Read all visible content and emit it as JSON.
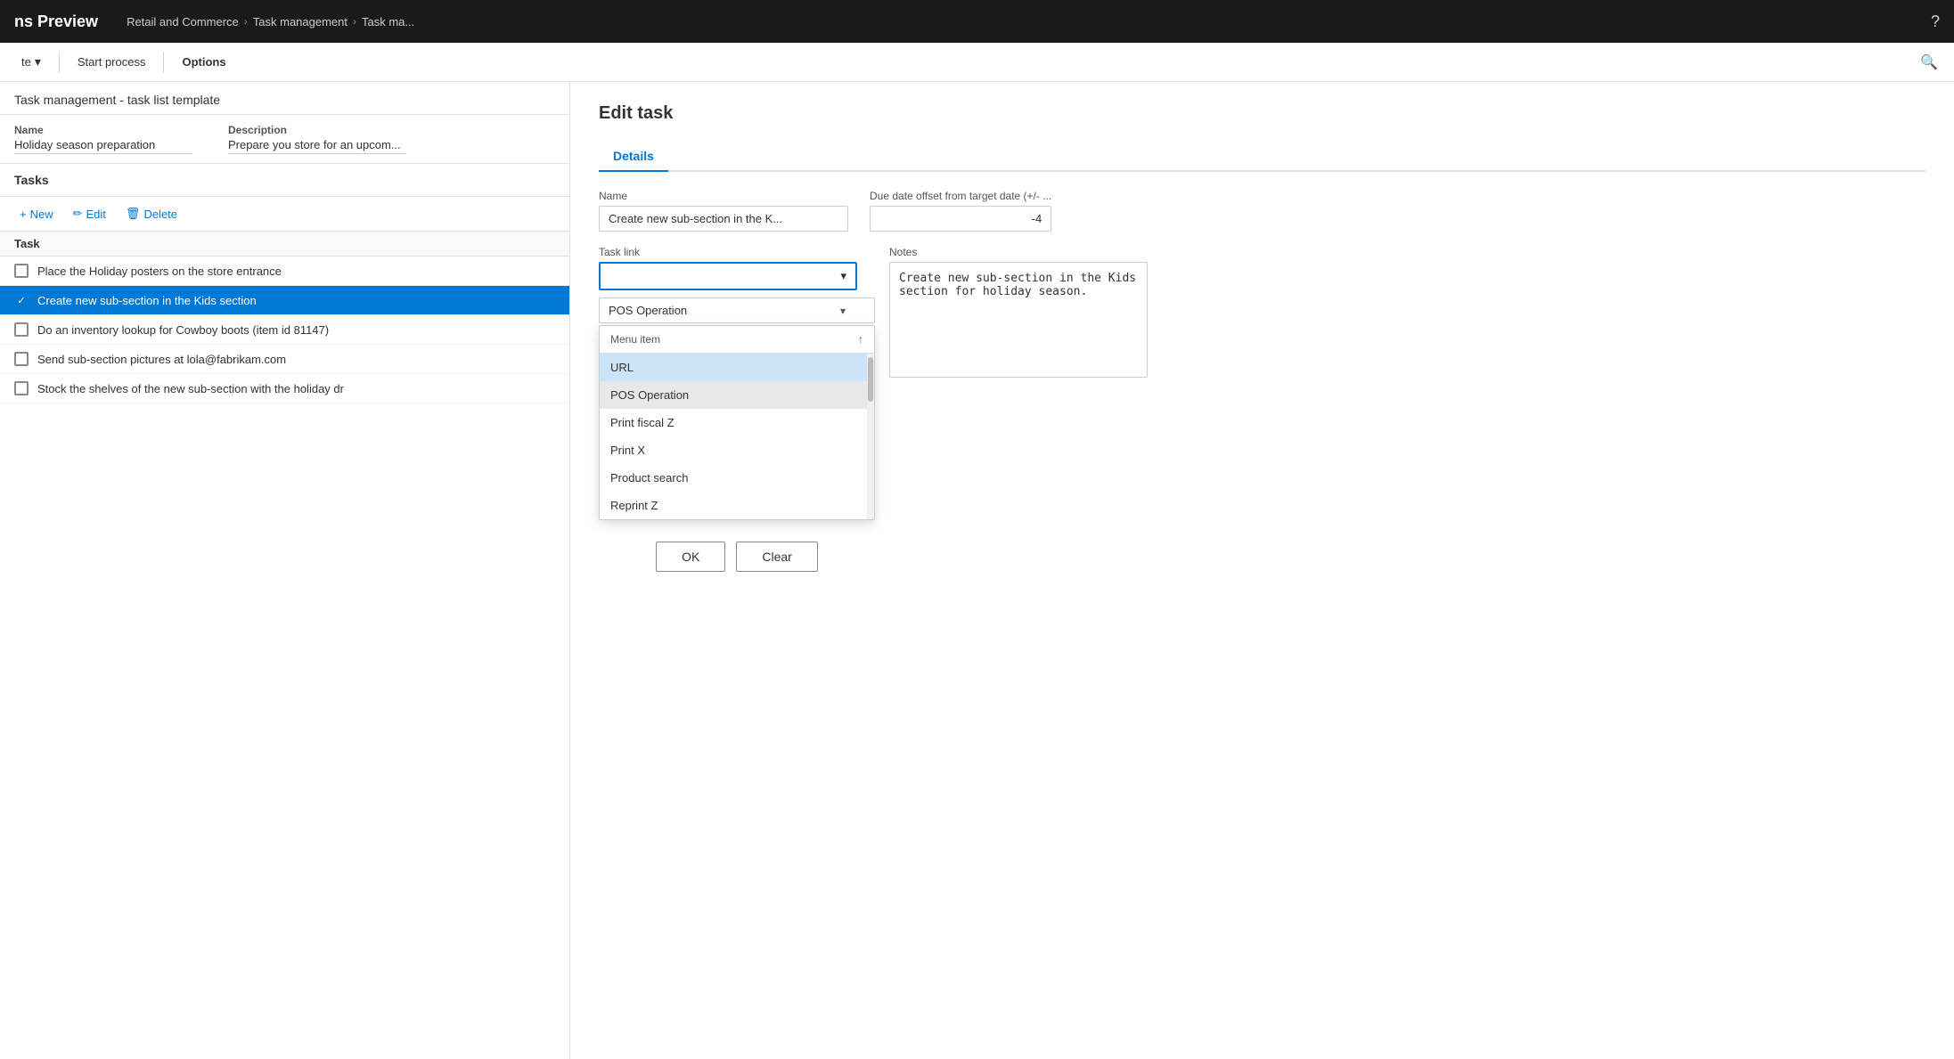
{
  "topNav": {
    "appTitle": "ns Preview",
    "breadcrumb": [
      "Retail and Commerce",
      "Task management",
      "Task ma..."
    ],
    "helpIcon": "?"
  },
  "toolbar": {
    "updateLabel": "te",
    "startProcessLabel": "Start process",
    "optionsLabel": "Options",
    "searchIcon": "🔍"
  },
  "leftPanel": {
    "pageTitle": "Task management - task list template",
    "nameLabel": "Name",
    "nameValue": "Holiday season preparation",
    "descriptionLabel": "Description",
    "descriptionValue": "Prepare you store for an upcom...",
    "tasksHeader": "Tasks",
    "newLabel": "+ New",
    "editLabel": "Edit",
    "deleteLabel": "Delete",
    "taskHeaderLabel": "Task",
    "tasks": [
      {
        "id": 1,
        "text": "Place the Holiday posters on the store entrance",
        "checked": false,
        "selected": false
      },
      {
        "id": 2,
        "text": "Create new sub-section in the Kids section",
        "checked": true,
        "selected": true
      },
      {
        "id": 3,
        "text": "Do an inventory lookup for Cowboy boots (item id 81147)",
        "checked": false,
        "selected": false
      },
      {
        "id": 4,
        "text": "Send sub-section pictures at lola@fabrikam.com",
        "checked": false,
        "selected": false
      },
      {
        "id": 5,
        "text": "Stock the shelves of the new sub-section with the holiday dr",
        "checked": false,
        "selected": false
      }
    ]
  },
  "rightPanel": {
    "title": "Edit task",
    "tabs": [
      "Details"
    ],
    "activeTab": "Details",
    "nameLabel": "Name",
    "nameValue": "Create new sub-section in the K...",
    "dueDateLabel": "Due date offset from target date (+/- ...",
    "dueDateValue": "-4",
    "taskLinkLabel": "Task link",
    "taskLinkValue": "",
    "taskLinkPlaceholder": "",
    "notesLabel": "Notes",
    "notesValue": "Create new sub-section in the Kids section for holiday season.",
    "dropdown": {
      "selectedValue": "POS Operation",
      "items": [
        {
          "label": "Menu item",
          "type": "header"
        },
        {
          "label": "URL",
          "highlighted": true
        },
        {
          "label": "POS Operation",
          "selected": true
        },
        {
          "label": "Print fiscal Z",
          "highlighted": false
        },
        {
          "label": "Print X",
          "highlighted": false
        },
        {
          "label": "Product search",
          "highlighted": false
        },
        {
          "label": "Reprint Z",
          "highlighted": false
        }
      ]
    },
    "okLabel": "OK",
    "clearLabel": "Clear"
  }
}
